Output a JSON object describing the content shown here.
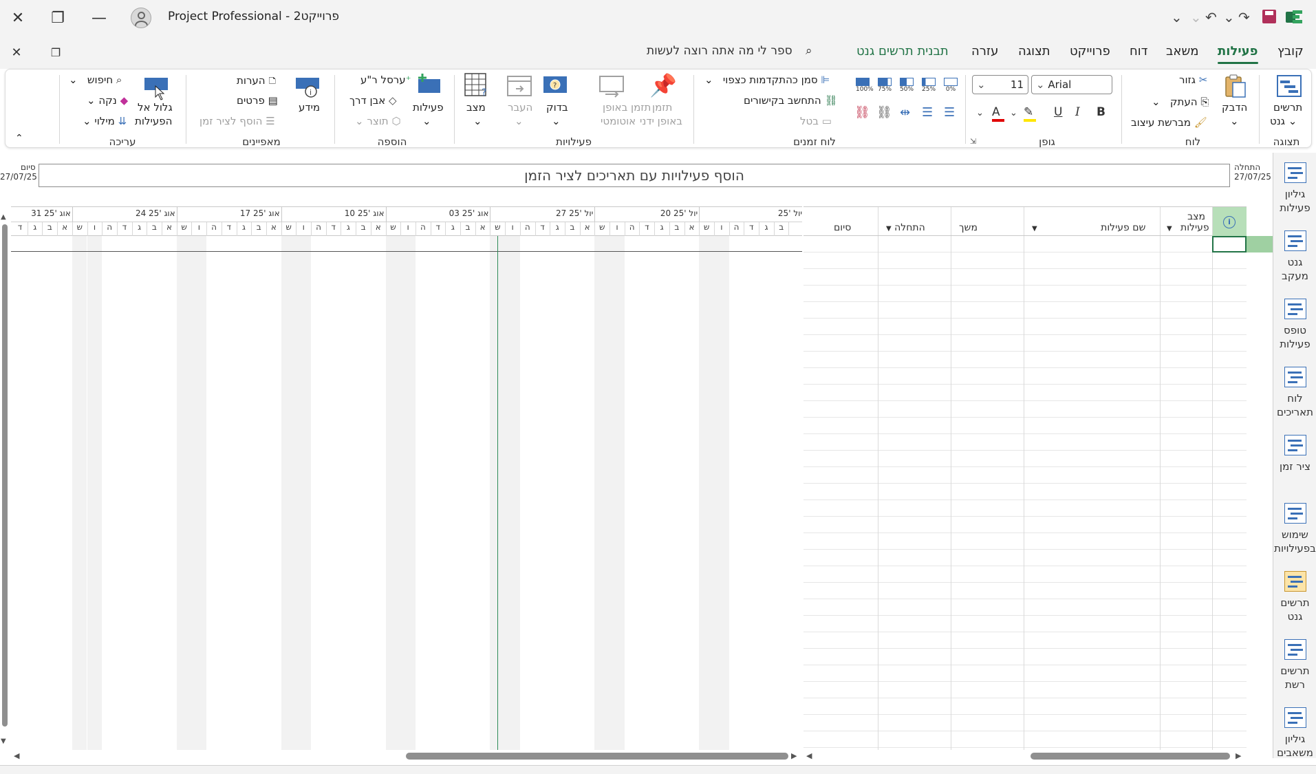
{
  "titlebar": {
    "title": "Project Professional  -  פרוייקט2"
  },
  "tabs": {
    "file": "קובץ",
    "task": "פעילות",
    "resource": "משאב",
    "report": "דוח",
    "project": "פרוייקט",
    "view": "תצוגה",
    "help": "עזרה",
    "gantt_format": "תבנית תרשים גנט",
    "tell_me": "ספר לי מה אתה רוצה לעשות"
  },
  "ribbon": {
    "view": {
      "label": "תצוגה",
      "gantt_chart": "תרשים",
      "gantt_chart2": "גנט"
    },
    "clipboard": {
      "label": "לוח",
      "paste": "הדבק",
      "cut": "גזור",
      "copy": "העתק",
      "format_painter": "מברשת עיצוב"
    },
    "font": {
      "label": "גופן",
      "font_name": "Arial",
      "font_size": "11",
      "bold": "B",
      "italic": "I",
      "underline": "U"
    },
    "schedule": {
      "label": "לוח זמנים",
      "mark_on_track": "סמן כהתקדמות כצפוי",
      "respect_links": "התחשב בקישורים",
      "inactivate": "בטל",
      "p0": "0%",
      "p25": "25%",
      "p50": "50%",
      "p75": "75%",
      "p100": "100%"
    },
    "tasks": {
      "label": "פעילויות",
      "manual": "תזמן",
      "manual2": "באופן ידני",
      "auto": "תזמן באופן",
      "auto2": "אוטומטי",
      "inspect": "בדוק",
      "move": "העבר",
      "mode": "מצב"
    },
    "insert": {
      "label": "הוספה",
      "task": "פעילות",
      "summary": "ר\"ע",
      "summary2": "ערסל",
      "milestone": "אבן דרך",
      "deliverable": "תוצר"
    },
    "properties": {
      "label": "מאפיינים",
      "information": "מידע",
      "notes": "הערות",
      "details": "פרטים",
      "add_to_timeline": "הוסף לציר זמן"
    },
    "editing": {
      "label": "עריכה",
      "scroll_to_task": "גלול אל",
      "scroll_to_task2": "הפעילות",
      "find": "חיפוש",
      "clear": "נקה",
      "fill": "מילוי"
    }
  },
  "timeline": {
    "start_label": "התחלה",
    "start_date": "27/07/25",
    "finish_label": "סיום",
    "finish_date": "27/07/25",
    "placeholder": "הוסף פעילויות עם תאריכים לציר הזמן"
  },
  "chart": {
    "weeks": [
      "31 אוג '25",
      "24 אוג '25",
      "17 אוג '25",
      "10 אוג '25",
      "03 אוג '25",
      "27 יול '25",
      "20 יול '25",
      "יול '25"
    ],
    "day_letters": [
      "ד",
      "ג",
      "ב",
      "א",
      "ש",
      "ו",
      "ה",
      "ד",
      "ג",
      "ב",
      "א",
      "ש",
      "ו",
      "ה",
      "ד",
      "ג",
      "ב",
      "א",
      "ש",
      "ו",
      "ה",
      "ד",
      "ג",
      "ב",
      "א",
      "ש",
      "ו",
      "ה",
      "ד",
      "ג",
      "ב",
      "א",
      "ש",
      "ו",
      "ה",
      "ד",
      "ג",
      "ב",
      "א",
      "ש",
      "ו",
      "ה",
      "ד",
      "ג",
      "ב",
      "א",
      "ש",
      "ו",
      "ה",
      "ד",
      "ג",
      "ב"
    ]
  },
  "grid": {
    "columns": {
      "mode": "מצב",
      "mode2": "פעילות",
      "name": "שם פעילות",
      "duration": "משך",
      "start": "התחלה",
      "finish": "סיום"
    }
  },
  "viewbar": {
    "items": [
      {
        "l1": "גיליון",
        "l2": "פעילות"
      },
      {
        "l1": "גנט",
        "l2": "מעקב"
      },
      {
        "l1": "טופס",
        "l2": "פעילות"
      },
      {
        "l1": "לוח",
        "l2": "תאריכים"
      },
      {
        "l1": "ציר זמן",
        "l2": ""
      },
      {
        "l1": "שימוש",
        "l2": "בפעילויות"
      },
      {
        "l1": "תרשים",
        "l2": "גנט"
      },
      {
        "l1": "תרשים",
        "l2": "רשת"
      },
      {
        "l1": "גיליון",
        "l2": "משאבים"
      }
    ]
  },
  "colors": {
    "accent": "#217346",
    "today": "#2e8b57",
    "icon_blue": "#3a70b7"
  }
}
